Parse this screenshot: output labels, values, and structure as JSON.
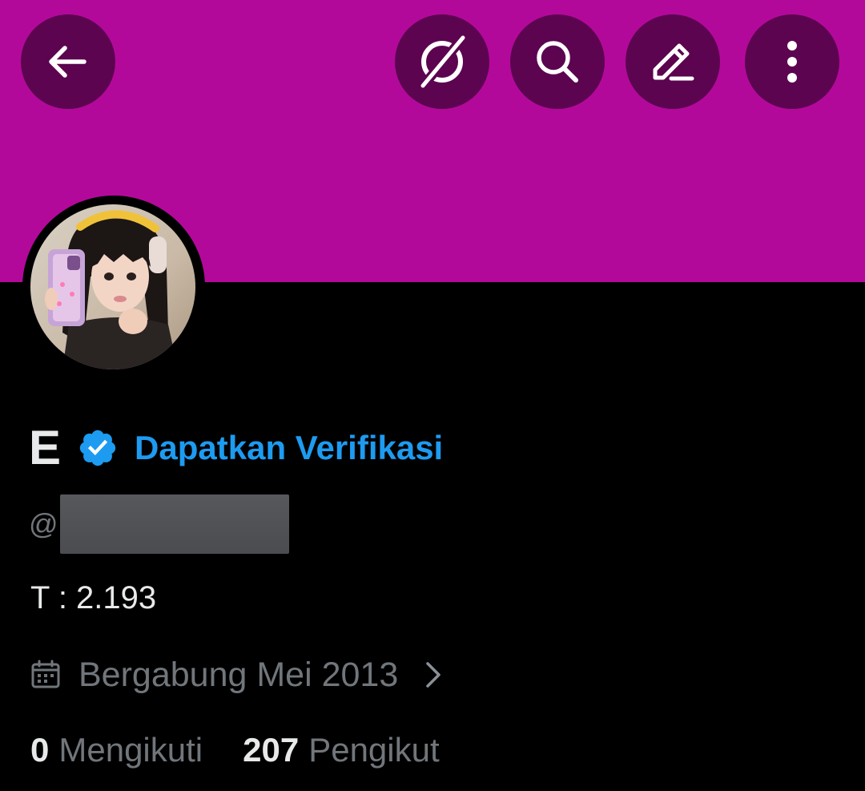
{
  "colors": {
    "banner": "#b3099b",
    "button_bg": "#5c0450",
    "background": "#000000",
    "primary_text": "#e7e9ea",
    "secondary_text": "#71767b",
    "accent": "#1d9bf0"
  },
  "header": {
    "back_icon": "arrow-left-icon",
    "actions": [
      "grok-icon",
      "search-icon",
      "edit-icon",
      "more-vertical-icon"
    ]
  },
  "profile": {
    "display_name": "E",
    "verified_badge_icon": "verified-badge-icon",
    "get_verified_label": "Dapatkan Verifikasi",
    "handle_prefix": "@",
    "bio": "T : 2.193",
    "joined": "Bergabung Mei 2013",
    "following_count": "0",
    "following_label": "Mengikuti",
    "followers_count": "207",
    "followers_label": "Pengikut"
  }
}
